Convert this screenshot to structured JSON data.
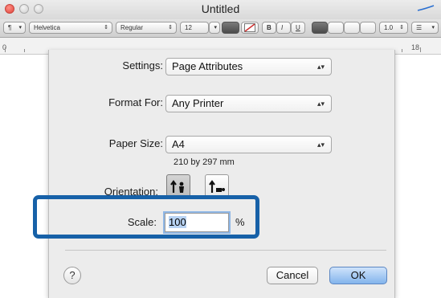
{
  "window": {
    "title": "Untitled"
  },
  "toolbar": {
    "paragraph": "¶",
    "font": "Helvetica",
    "style": "Regular",
    "size": "12",
    "bold": "B",
    "italic": "I",
    "underline": "U",
    "spacing": "1.0",
    "list": "☰"
  },
  "ruler": {
    "left": "0",
    "right": "18"
  },
  "dialog": {
    "settings_label": "Settings:",
    "settings_value": "Page Attributes",
    "format_for_label": "Format For:",
    "format_for_value": "Any Printer",
    "paper_size_label": "Paper Size:",
    "paper_size_value": "A4",
    "paper_dims": "210 by 297 mm",
    "orientation_label": "Orientation:",
    "scale_label": "Scale:",
    "scale_value": "100",
    "scale_unit": "%",
    "help": "?",
    "cancel": "Cancel",
    "ok": "OK"
  },
  "colors": {
    "highlight": "#1761a8",
    "default_button": "#83b4ec"
  }
}
